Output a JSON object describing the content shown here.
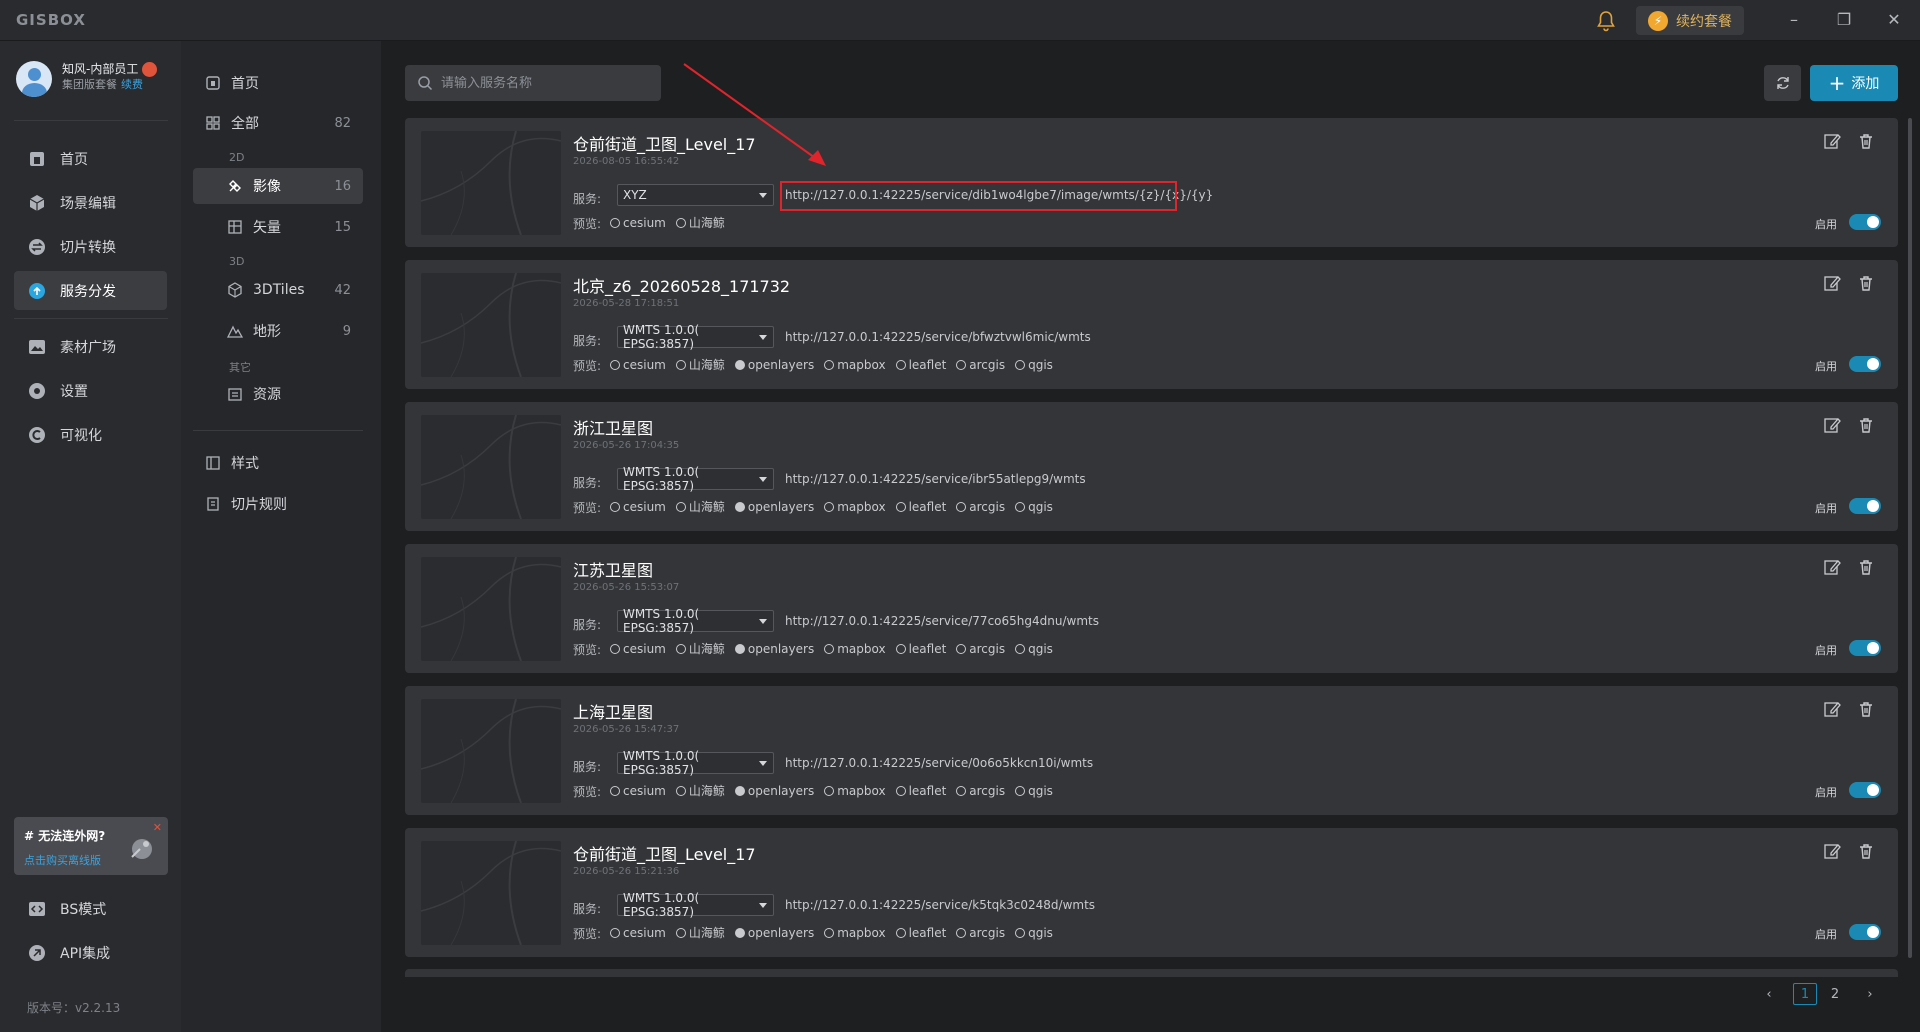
{
  "app": {
    "logo": "GISBOX",
    "renew_label": "续约套餐"
  },
  "user": {
    "name": "知风-内部员工",
    "plan": "集团版套餐",
    "renew_link": "续费"
  },
  "nav": {
    "items": [
      {
        "label": "首页",
        "icon": "home-icon"
      },
      {
        "label": "场景编辑",
        "icon": "cube-icon"
      },
      {
        "label": "切片转换",
        "icon": "swap-icon"
      },
      {
        "label": "服务分发",
        "icon": "cloud-upload-icon",
        "active": true
      },
      {
        "label": "素材广场",
        "icon": "image-icon"
      },
      {
        "label": "设置",
        "icon": "settings-icon"
      },
      {
        "label": "可视化",
        "icon": "visual-icon"
      }
    ],
    "bottom": [
      {
        "label": "BS模式",
        "icon": "code-icon"
      },
      {
        "label": "API集成",
        "icon": "api-icon"
      }
    ],
    "promo_title": "# 无法连外网?",
    "promo_link": "点击购买离线版",
    "version": "版本号：v2.2.13"
  },
  "categories": {
    "home": "首页",
    "all": {
      "label": "全部",
      "count": "82"
    },
    "group_2d": "2D",
    "imagery": {
      "label": "影像",
      "count": "16"
    },
    "vector": {
      "label": "矢量",
      "count": "15"
    },
    "group_3d": "3D",
    "tiles3d": {
      "label": "3DTiles",
      "count": "42"
    },
    "terrain": {
      "label": "地形",
      "count": "9"
    },
    "group_other": "其它",
    "resource": "资源",
    "style": "样式",
    "tile_rule": "切片规则"
  },
  "toolbar": {
    "search_placeholder": "请输入服务名称",
    "add_label": "添加"
  },
  "labels": {
    "service": "服务:",
    "preview": "预览:",
    "enable": "启用"
  },
  "preview_targets": [
    "cesium",
    "山海鲸",
    "openlayers",
    "mapbox",
    "leaflet",
    "arcgis",
    "qgis"
  ],
  "services": [
    {
      "title": "仓前街道_卫图_Level_17",
      "time": "2026-08-05 16:55:42",
      "type": "XYZ",
      "url": "http://127.0.0.1:42225/service/dib1wo4lgbe7/image/wmts/{z}/{x}/{y}",
      "previews": [
        "cesium",
        "山海鲸"
      ],
      "highlight": true
    },
    {
      "title": "北京_z6_20260528_171732",
      "time": "2026-05-28 17:18:51",
      "type": "WMTS 1.0.0( EPSG:3857)",
      "url": "http://127.0.0.1:42225/service/bfwztvwl6mic/wmts",
      "previews": [
        "cesium",
        "山海鲸",
        "openlayers",
        "mapbox",
        "leaflet",
        "arcgis",
        "qgis"
      ]
    },
    {
      "title": "浙江卫星图",
      "time": "2026-05-26 17:04:35",
      "type": "WMTS 1.0.0( EPSG:3857)",
      "url": "http://127.0.0.1:42225/service/ibr55atlepg9/wmts",
      "previews": [
        "cesium",
        "山海鲸",
        "openlayers",
        "mapbox",
        "leaflet",
        "arcgis",
        "qgis"
      ]
    },
    {
      "title": "江苏卫星图",
      "time": "2026-05-26 15:53:07",
      "type": "WMTS 1.0.0( EPSG:3857)",
      "url": "http://127.0.0.1:42225/service/77co65hg4dnu/wmts",
      "previews": [
        "cesium",
        "山海鲸",
        "openlayers",
        "mapbox",
        "leaflet",
        "arcgis",
        "qgis"
      ]
    },
    {
      "title": "上海卫星图",
      "time": "2026-05-26 15:47:37",
      "type": "WMTS 1.0.0( EPSG:3857)",
      "url": "http://127.0.0.1:42225/service/0o6o5kkcn10i/wmts",
      "previews": [
        "cesium",
        "山海鲸",
        "openlayers",
        "mapbox",
        "leaflet",
        "arcgis",
        "qgis"
      ]
    },
    {
      "title": "仓前街道_卫图_Level_17",
      "time": "2026-05-26 15:21:36",
      "type": "WMTS 1.0.0( EPSG:3857)",
      "url": "http://127.0.0.1:42225/service/k5tqk3c0248d/wmts",
      "previews": [
        "cesium",
        "山海鲸",
        "openlayers",
        "mapbox",
        "leaflet",
        "arcgis",
        "qgis"
      ]
    }
  ],
  "pagination": {
    "prev": "‹",
    "pages": [
      "1",
      "2"
    ],
    "current": "1",
    "next": "›"
  },
  "colors": {
    "accent": "#1a8ab4",
    "highlight": "#e0242c",
    "bg": "#1e1f21",
    "card": "#343538"
  }
}
